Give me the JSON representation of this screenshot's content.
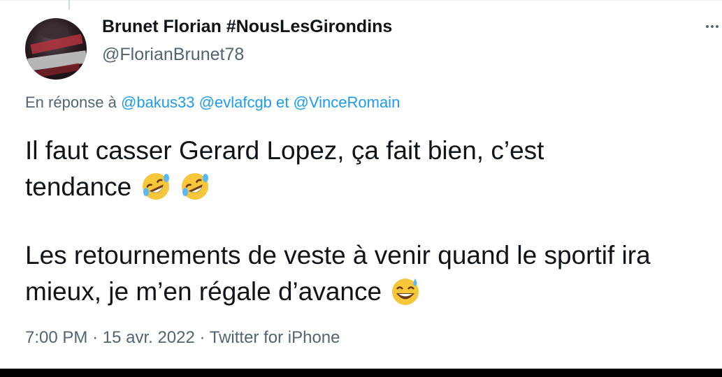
{
  "tweet": {
    "display_name": "Brunet Florian #NousLesGirondins",
    "handle": "@FlorianBrunet78",
    "reply": {
      "prefix": "En réponse à",
      "mentions": [
        "@bakus33",
        "@evlafcgb",
        "@VinceRomain"
      ],
      "conjunction": "et"
    },
    "text": {
      "line1": "Il faut casser Gerard Lopez, ça fait bien, c’est",
      "line2": "tendance",
      "line3": "Les retournements de veste à venir quand le sportif ira",
      "line4": "mieux, je m’en régale d’avance"
    },
    "emojis": {
      "line2": [
        "rolling-on-floor-laughing-emoji",
        "rolling-on-floor-laughing-emoji"
      ],
      "line4": [
        "grinning-sweat-emoji"
      ]
    },
    "meta": {
      "time": "7:00 PM",
      "date": "15 avr. 2022",
      "source": "Twitter for iPhone",
      "separator": "·"
    }
  },
  "colors": {
    "text": "#0f1419",
    "secondary": "#536471",
    "link": "#1d9bf0"
  }
}
